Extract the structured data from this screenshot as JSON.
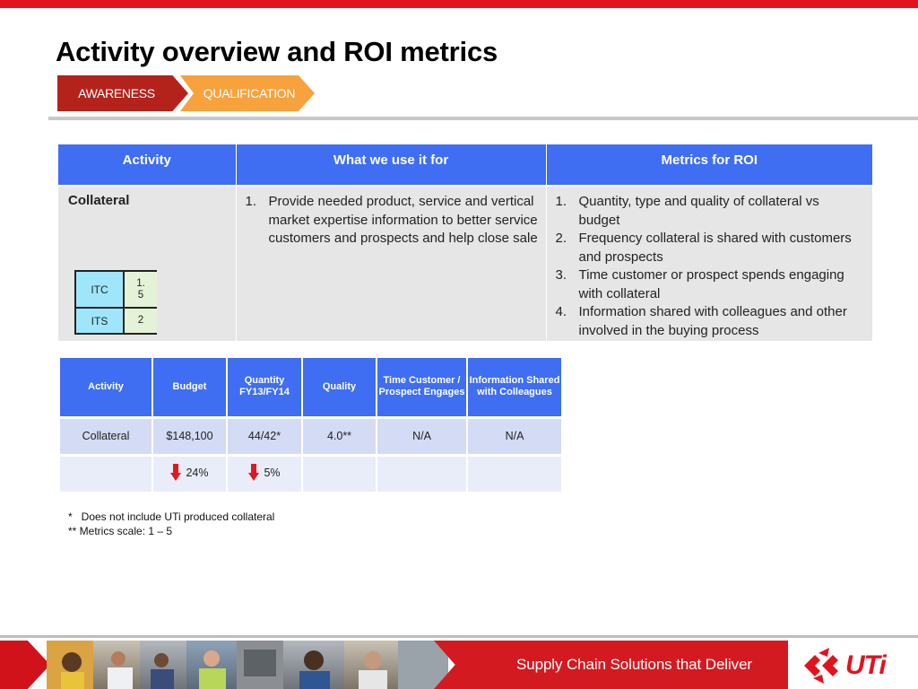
{
  "title": "Activity overview and ROI metrics",
  "stages": [
    "AWARENESS",
    "QUALIFICATION"
  ],
  "overview_table": {
    "headers": [
      "Activity",
      "What we use it for",
      "Metrics for ROI"
    ],
    "row": {
      "activity": "Collateral",
      "uses": [
        {
          "n": "1.",
          "text": "Provide needed product, service and vertical market expertise information to better service customers and prospects and help close sale"
        }
      ],
      "metrics": [
        {
          "n": "1.",
          "text": "Quantity, type and quality of collateral vs budget"
        },
        {
          "n": "2.",
          "text": "Frequency collateral is shared with customers and prospects"
        },
        {
          "n": "3.",
          "text": "Time customer or prospect spends engaging with collateral"
        },
        {
          "n": "4.",
          "text": "Information shared with colleagues and other involved in the buying process"
        }
      ]
    },
    "mini": [
      {
        "key": "ITC",
        "value": "1.5"
      },
      {
        "key": "ITS",
        "value": "2"
      }
    ]
  },
  "metrics_table": {
    "headers": [
      "Activity",
      "Budget",
      "Quantity FY13/FY14",
      "Quality",
      "Time Customer / Prospect Engages",
      "Information Shared with Colleagues"
    ],
    "rows": [
      [
        "Collateral",
        "$148,100",
        "44/42*",
        "4.0**",
        "N/A",
        "N/A"
      ]
    ],
    "changes": {
      "budget": {
        "direction": "down",
        "icon": "down-arrow-icon",
        "value": "24%"
      },
      "quantity": {
        "direction": "down",
        "icon": "down-arrow-icon",
        "value": "5%"
      }
    }
  },
  "notes": [
    "*   Does not include UTi produced collateral",
    "** Metrics scale: 1 – 5"
  ],
  "footer": {
    "tagline": "Supply Chain Solutions that Deliver",
    "logo": "UTi"
  },
  "colors": {
    "brand_red": "#e2131f",
    "awareness": "#b3231c",
    "qualification": "#f7a23c",
    "table_header": "#3f6ef3",
    "arrow_down": "#e0191f"
  }
}
